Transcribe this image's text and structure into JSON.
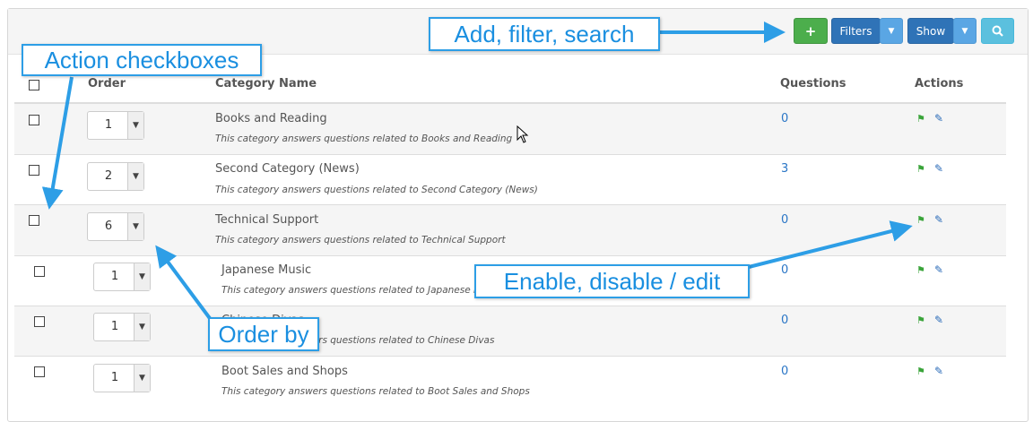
{
  "toolbar": {
    "add_icon": "plus-icon",
    "add_label": "+",
    "filters_label": "Filters",
    "show_label": "Show",
    "caret_icon": "caret-down-icon",
    "search_icon": "search-icon"
  },
  "table": {
    "headers": {
      "order": "Order",
      "category": "Category Name",
      "questions": "Questions",
      "actions": "Actions"
    },
    "rows": [
      {
        "order": "1",
        "name": "Books and Reading",
        "desc": "This category answers questions related to Books and Reading",
        "questions": "0"
      },
      {
        "order": "2",
        "name": "Second Category (News)",
        "desc": "This category answers questions related to Second Category (News)",
        "questions": "3"
      },
      {
        "order": "6",
        "name": "Technical Support",
        "desc": "This category answers questions related to Technical Support",
        "questions": "0"
      },
      {
        "order": "1",
        "name": "Japanese Music",
        "desc": "This category answers questions related to Japanese Music",
        "questions": "0"
      },
      {
        "order": "1",
        "name": "Chinese Divas",
        "desc": "This category answers questions related to Chinese Divas",
        "questions": "0"
      },
      {
        "order": "1",
        "name": "Boot Sales and Shops",
        "desc": "This category answers questions related to Boot Sales and Shops",
        "questions": "0"
      }
    ]
  },
  "annotations": {
    "add_filter_search": "Add, filter, search",
    "action_checkboxes": "Action checkboxes",
    "enable_disable_edit": "Enable, disable / edit",
    "order_by": "Order by"
  },
  "colors": {
    "add_button": "#4cae4c",
    "filters_button": "#2f73b7",
    "search_button": "#5bc0de",
    "callout": "#2d9ee6",
    "link": "#2a76c6",
    "flag": "#3aa43a"
  }
}
